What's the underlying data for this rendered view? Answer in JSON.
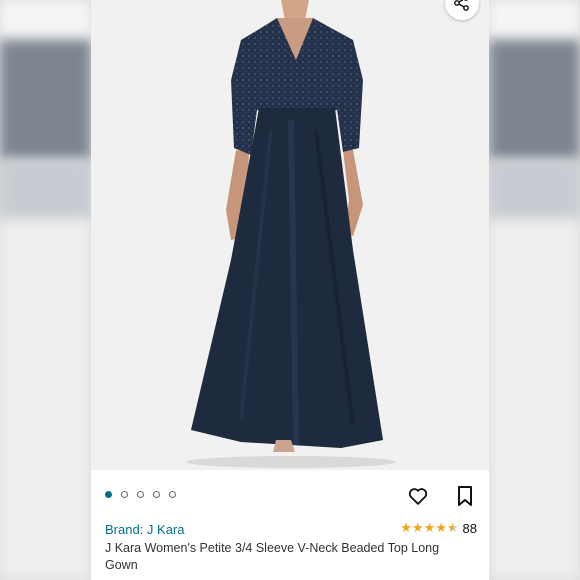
{
  "product": {
    "brand_label": "Brand: J Kara",
    "title": "J Kara Women's Petite 3/4 Sleeve V-Neck Beaded Top Long Gown",
    "rating": 4.5,
    "rating_count": "88"
  },
  "gallery": {
    "image_count": 5,
    "active_index": 0
  },
  "icons": {
    "share": "share-icon",
    "favorite": "heart-icon",
    "save": "bookmark-icon",
    "rating": "star-icon"
  },
  "colors": {
    "link": "#007185",
    "star": "#f0a41b",
    "dress": "#1e2a3d"
  }
}
